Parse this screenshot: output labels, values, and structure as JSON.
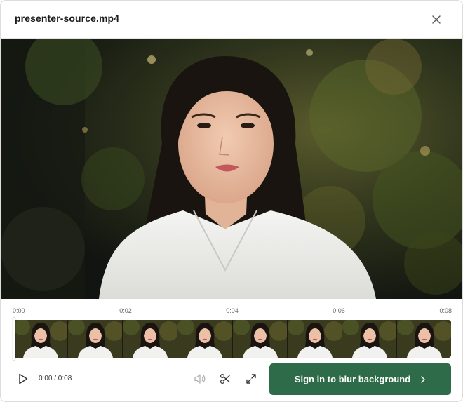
{
  "dialog": {
    "title": "presenter-source.mp4"
  },
  "timeline": {
    "ticks": [
      "0:00",
      "0:02",
      "0:04",
      "0:06",
      "0:08"
    ],
    "frame_count": 8,
    "playhead_progress": 0
  },
  "controls": {
    "time_display": "0:00 / 0:08",
    "cta_label": "Sign in to blur background"
  },
  "icons": {
    "close": "close-icon",
    "play": "play-icon",
    "volume": "volume-icon",
    "trim": "scissors-icon",
    "fullscreen": "expand-icon",
    "cta_arrow": "chevron-right-icon"
  },
  "colors": {
    "cta_background": "#2e6b48",
    "cta_text": "#ffffff"
  }
}
